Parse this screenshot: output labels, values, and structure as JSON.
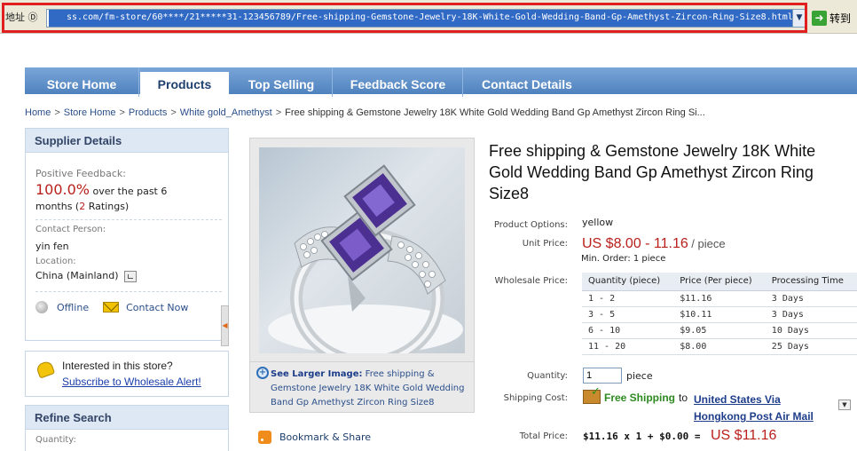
{
  "address_bar": {
    "label": "地址 Ⓓ",
    "url": "ss.com/fm-store/60****/21*****31-123456789/Free-shipping-Gemstone-Jewelry-18K-White-Gold-Wedding-Band-Gp-Amethyst-Zircon-Ring-Size8.html",
    "go_label": "转到"
  },
  "nav": {
    "tabs": [
      "Store Home",
      "Products",
      "Top Selling",
      "Feedback Score",
      "Contact Details"
    ],
    "active": "Products"
  },
  "breadcrumb": {
    "items": [
      "Home",
      "Store Home",
      "Products",
      "White gold_Amethyst"
    ],
    "current": "Free shipping & Gemstone Jewelry 18K White Gold Wedding Band Gp Amethyst Zircon Ring Si...",
    "separator": ">"
  },
  "supplier": {
    "header": "Supplier Details",
    "feedback_label": "Positive Feedback:",
    "feedback_pct": "100.0%",
    "feedback_text_1": "over the past 6",
    "feedback_text_2": "months (",
    "ratings_count": "2",
    "feedback_text_3": "Ratings)",
    "contact_label": "Contact Person:",
    "contact_name": "yin fen",
    "location_label": "Location:",
    "location_value": "China (Mainland)",
    "offline": "Offline",
    "contact_now": "Contact Now"
  },
  "interest": {
    "text": "Interested in this store?",
    "link": "Subscribe to Wholesale Alert!"
  },
  "refine": {
    "header": "Refine Search",
    "quantity_label": "Quantity:"
  },
  "image": {
    "caption_strong": "See Larger Image:",
    "caption_text": "Free shipping & Gemstone Jewelry 18K White Gold Wedding Band Gp Amethyst Zircon Ring Size8"
  },
  "bookmark": "Bookmark & Share",
  "product": {
    "title": "Free shipping & Gemstone Jewelry 18K White Gold Wedding Band Gp Amethyst Zircon Ring Size8",
    "options_label": "Product Options:",
    "options_value": "yellow",
    "unit_price_label": "Unit Price:",
    "price_range": "US $8.00 - 11.16",
    "per_unit": "/ piece",
    "min_order": "Min. Order: 1 piece",
    "wholesale_label": "Wholesale Price:",
    "wholesale_headers": [
      "Quantity (piece)",
      "Price (Per piece)",
      "Processing Time"
    ],
    "wholesale_rows": [
      [
        "1 - 2",
        "$11.16",
        "3 Days"
      ],
      [
        "3 - 5",
        "$10.11",
        "3 Days"
      ],
      [
        "6 - 10",
        "$9.05",
        "10 Days"
      ],
      [
        "11 - 20",
        "$8.00",
        "25 Days"
      ]
    ],
    "quantity_label": "Quantity:",
    "quantity_value": "1",
    "quantity_unit": "piece",
    "shipping_label": "Shipping Cost:",
    "free_shipping": "Free Shipping",
    "ship_to": "to",
    "ship_method": "United States Via Hongkong Post Air Mail",
    "total_label": "Total Price:",
    "total_formula": "$11.16 x 1 + $0.00 =",
    "total_amount": "US $11.16"
  },
  "colors": {
    "nav_blue": "#4f82be",
    "price_red": "#b9201c",
    "link_blue": "#2b4f8a",
    "free_ship_green": "#2c8a1f",
    "highlight_red": "#e02020"
  }
}
